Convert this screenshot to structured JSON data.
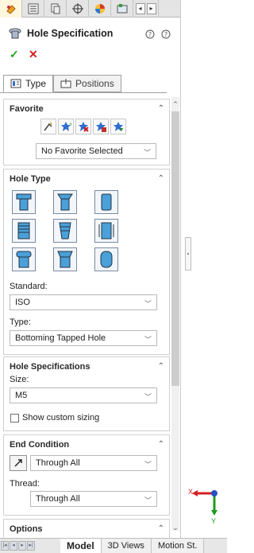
{
  "panel": {
    "top_tabs": [
      {
        "icon": "property-manager-icon"
      },
      {
        "icon": "feature-tree-icon"
      },
      {
        "icon": "configuration-icon"
      },
      {
        "icon": "dimxpert-icon"
      },
      {
        "icon": "appearance-icon"
      },
      {
        "icon": "display-manager-icon"
      }
    ],
    "title": "Hole Specification",
    "ok_symbol": "✓",
    "cancel_symbol": "✕",
    "tabs": [
      {
        "label": "Type",
        "active": true
      },
      {
        "label": "Positions",
        "active": false
      }
    ]
  },
  "favorite": {
    "title": "Favorite",
    "selected": "No Favorite Selected"
  },
  "hole_type": {
    "title": "Hole Type",
    "types": [
      "counterbore",
      "countersink",
      "hole",
      "straight-tap",
      "tapered-tap",
      "legacy-hole",
      "counterbore-slot",
      "countersink-slot",
      "slot"
    ],
    "standard_label": "Standard:",
    "standard_value": "ISO",
    "type_label": "Type:",
    "type_value": "Bottoming Tapped Hole"
  },
  "hole_spec": {
    "title": "Hole Specifications",
    "size_label": "Size:",
    "size_value": "M5",
    "custom_label": "Show custom sizing"
  },
  "end_condition": {
    "title": "End Condition",
    "value": "Through All",
    "thread_label": "Thread:",
    "thread_value": "Through All"
  },
  "options": {
    "title": "Options"
  },
  "bottom_tabs": [
    {
      "label": "Model",
      "active": true
    },
    {
      "label": "3D Views",
      "active": false
    },
    {
      "label": "Motion St.",
      "active": false
    }
  ],
  "triad": {
    "x_label": "X",
    "y_label": "Y"
  },
  "colors": {
    "accent": "#2f6fd0",
    "ok": "#21a321",
    "cancel": "#d42020"
  }
}
